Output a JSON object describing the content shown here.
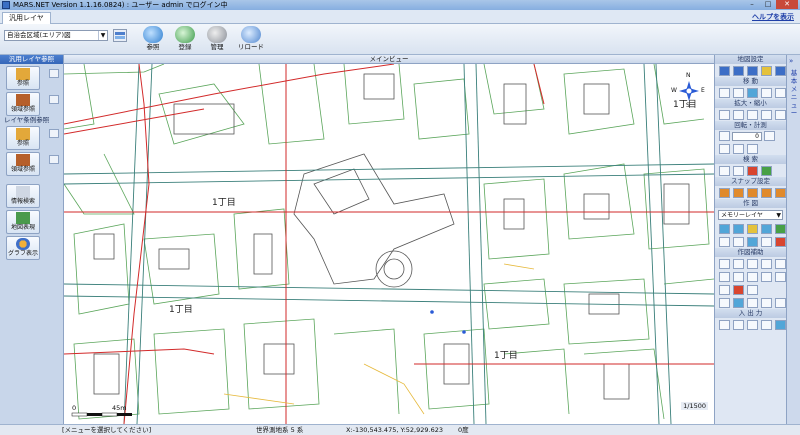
{
  "window": {
    "title": "MARS.NET Version 1.1.16.0824) : ユーザー admin でログイン中",
    "controls": {
      "minimize": "–",
      "maximize": "□",
      "close": "✕"
    }
  },
  "tabs": {
    "active": "汎用レイヤ",
    "help_link": "ヘルプを表示"
  },
  "toolbar": {
    "area_select": "自治会区域(エリア)図",
    "buttons": [
      {
        "label": "参照"
      },
      {
        "label": "登録"
      },
      {
        "label": "管理"
      },
      {
        "label": "リロード"
      }
    ]
  },
  "left_panel": {
    "header": "汎用レイヤ参照",
    "section1_label": "",
    "section2_label": "レイヤ条例参照",
    "btn_ref1": "参照",
    "btn_region1": "領域参照",
    "btn_ref2": "参照",
    "btn_region2": "領域参照",
    "btn_search": "情報検索",
    "btn_map_display": "地図表現",
    "btn_graph": "グラフ表示"
  },
  "map": {
    "header": "メインビュー",
    "labels": [
      "1丁目",
      "1丁目",
      "1丁目",
      "1丁目"
    ],
    "scale_zero": "0",
    "scale_mid": "45m",
    "ratio": "1/1500",
    "compass": {
      "n": "N",
      "s": "S",
      "w": "W",
      "e": "E"
    }
  },
  "right_panel": {
    "sec_map_settings": "地図設定",
    "sec_move": "移 動",
    "sec_zoom": "拡大・縮小",
    "sec_rotate": "回転・計測",
    "rotate_value": "0",
    "sec_search": "検 索",
    "sec_snap": "スナップ設定",
    "sec_draw": "作 図",
    "layer_select": "メモリーレイヤ",
    "sec_draw_edit": "作図補助",
    "sec_io": "入 出 力"
  },
  "side_menu": {
    "label": "基本メニュー",
    "chevron": "»"
  },
  "status": {
    "message": "[メニューを選択してください]",
    "crs": "世界測地系 5 系",
    "coords": "X:-130,543.475, Y:52,929.623",
    "angle": "0度"
  }
}
